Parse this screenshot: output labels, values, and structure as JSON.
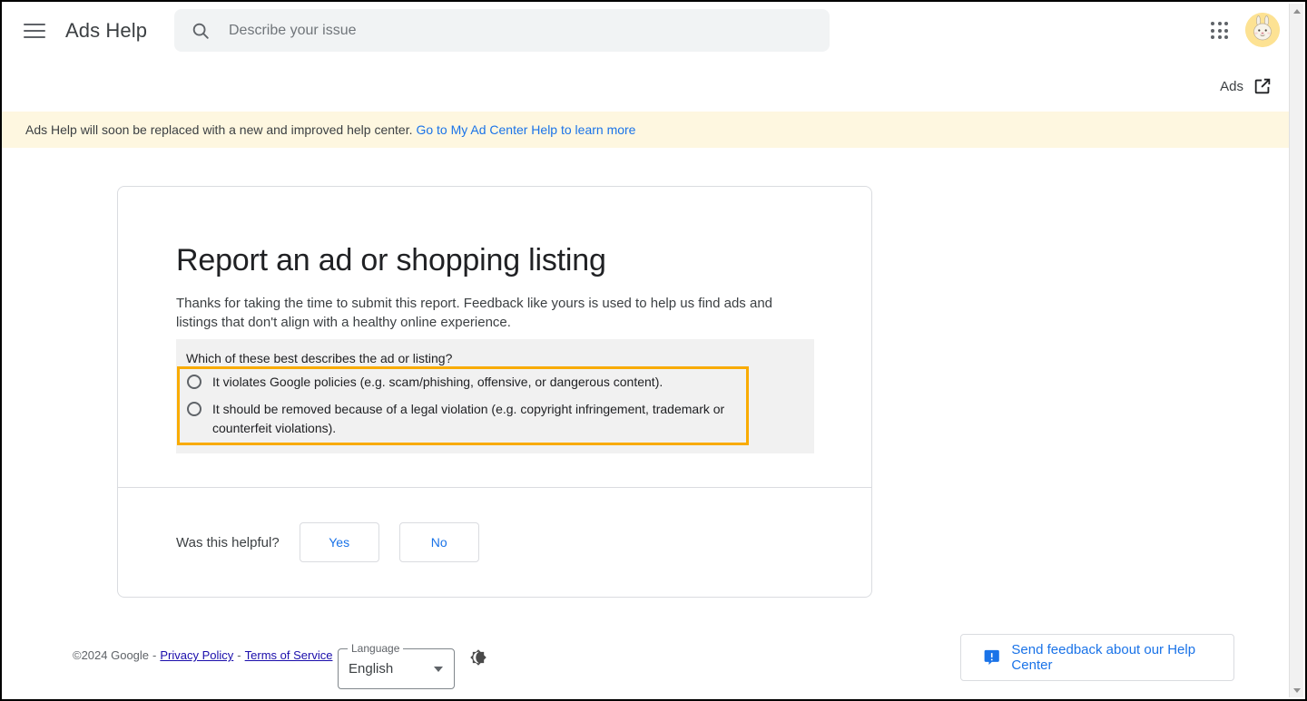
{
  "header": {
    "menu_icon": "hamburger-menu-icon",
    "brand": "Ads Help",
    "search": {
      "icon": "search-icon",
      "placeholder": "Describe your issue",
      "value": ""
    },
    "apps_icon": "apps-grid-icon",
    "avatar": "user-avatar-bunny",
    "product_link": {
      "label": "Ads",
      "icon": "open-in-new-icon"
    }
  },
  "banner": {
    "text": "Ads Help will soon be replaced with a new and improved help center.",
    "link_text": "Go to My Ad Center Help to learn more",
    "background": "#fef7e0",
    "link_color": "#1a73e8"
  },
  "card": {
    "title": "Report an ad or shopping listing",
    "description": "Thanks for taking the time to submit this report. Feedback like yours is used to help us find ads and listings that don't align with a healthy online experience.",
    "form": {
      "question": "Which of these best describes the ad or listing?",
      "options": [
        {
          "label": "It violates Google policies (e.g. scam/phishing, offensive, or dangerous content).",
          "selected": false
        },
        {
          "label": "It should be removed because of a legal violation (e.g. copyright infringement, trademark or counterfeit violations).",
          "selected": false
        }
      ],
      "highlight_color": "#f9ab00",
      "background": "#f1f1f1"
    },
    "helpful": {
      "label": "Was this helpful?",
      "yes_label": "Yes",
      "no_label": "No"
    }
  },
  "footer": {
    "copyright": "©2024 Google",
    "sep1": "-",
    "privacy_label": "Privacy Policy",
    "sep2": "-",
    "terms_label": "Terms of Service",
    "language": {
      "legend": "Language",
      "value": "English",
      "caret_icon": "chevron-down-icon"
    },
    "theme_toggle_icon": "dark-mode-icon",
    "feedback": {
      "icon": "feedback-icon",
      "label": "Send feedback about our Help Center",
      "color": "#1a73e8"
    }
  },
  "scrollbar": {
    "up_icon": "scroll-up-arrow-icon",
    "down_icon": "scroll-down-arrow-icon"
  }
}
